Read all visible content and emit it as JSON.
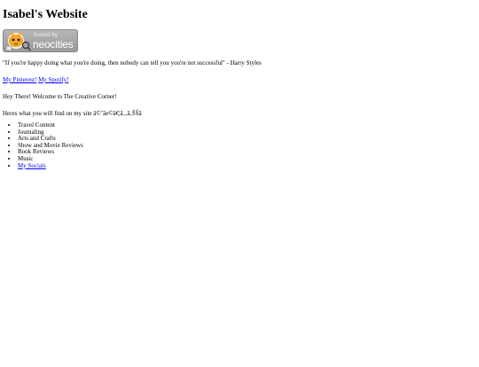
{
  "site": {
    "title": "Isabel's Website"
  },
  "badge": {
    "hosted_text": "hosted by",
    "brand_text": "neocities",
    "icon": "neocities-cat-icon",
    "colors": {
      "background": "#a8a8a8",
      "text": "#ffffff",
      "cat": "#f5a623"
    }
  },
  "quote": "\"If you're happy doing what you're doing, then nobody can tell you you're not successful\" - Harry Styles",
  "links": {
    "pinterest": "My Pinterest!",
    "spotify": "My Spotify!"
  },
  "welcome": "Hey There! Welcome to The Creative Corner!",
  "intro": "Heres what you will find on my site â©˜ãe©ã€¦ã‚‚ã‚ŠŠã",
  "list_items": [
    {
      "label": "Travel Content"
    },
    {
      "label": "Journaling"
    },
    {
      "label": "Arts and Crafts"
    },
    {
      "label": "Show and Movie Reviews"
    },
    {
      "label": "Book Reviews"
    },
    {
      "label": "Music"
    }
  ],
  "socials_link": "My Socials",
  "colors": {
    "link": "#0000ee",
    "text": "#000000",
    "background": "#ffffff"
  }
}
